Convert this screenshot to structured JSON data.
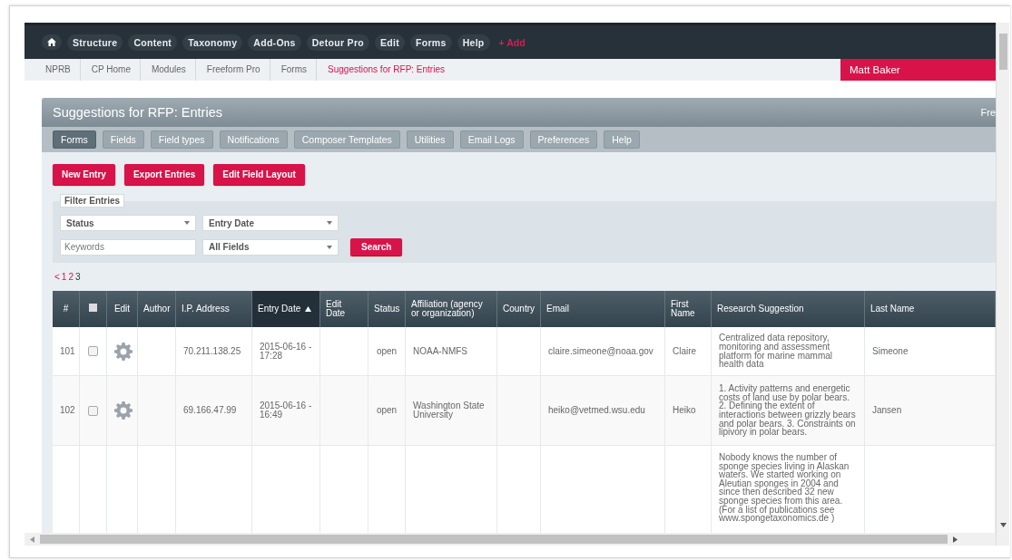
{
  "top_nav": [
    {
      "kind": "home"
    },
    {
      "kind": "menu",
      "label": "Structure"
    },
    {
      "kind": "menu",
      "label": "Content"
    },
    {
      "kind": "menu",
      "label": "Taxonomy"
    },
    {
      "kind": "menu",
      "label": "Add-Ons"
    },
    {
      "kind": "menu",
      "label": "Detour Pro"
    },
    {
      "kind": "menu",
      "label": "Edit"
    },
    {
      "kind": "menu",
      "label": "Forms"
    },
    {
      "kind": "menu",
      "label": "Help"
    },
    {
      "kind": "add",
      "label": "+ Add"
    }
  ],
  "breadcrumbs": [
    {
      "label": "NPRB",
      "current": false
    },
    {
      "label": "CP Home",
      "current": false
    },
    {
      "label": "Modules",
      "current": false
    },
    {
      "label": "Freeform Pro",
      "current": false
    },
    {
      "label": "Forms",
      "current": false
    },
    {
      "label": "Suggestions for RFP: Entries",
      "current": true
    }
  ],
  "user": "Matt Baker",
  "panel": {
    "title": "Suggestions for RFP: Entries",
    "title_right": "Fre",
    "tabs": [
      {
        "label": "Forms",
        "selected": true
      },
      {
        "label": "Fields",
        "selected": false
      },
      {
        "label": "Field types",
        "selected": false
      },
      {
        "label": "Notifications",
        "selected": false
      },
      {
        "label": "Composer Templates",
        "selected": false
      },
      {
        "label": "Utilities",
        "selected": false
      },
      {
        "label": "Email Logs",
        "selected": false
      },
      {
        "label": "Preferences",
        "selected": false
      },
      {
        "label": "Help",
        "selected": false
      }
    ],
    "actions": [
      "New Entry",
      "Export Entries",
      "Edit Field Layout"
    ],
    "filter": {
      "legend": "Filter Entries",
      "status_select": "Status",
      "date_select": "Entry Date",
      "keywords": {
        "placeholder": "Keywords"
      },
      "field_select": "All Fields",
      "search_button": "Search"
    },
    "pagination": [
      {
        "label": "<",
        "selected": false
      },
      {
        "label": "1",
        "selected": false
      },
      {
        "label": "2",
        "selected": false
      },
      {
        "label": "3",
        "selected": true
      }
    ],
    "table": {
      "columns": [
        {
          "kind": "text",
          "label": "#",
          "sorted": false
        },
        {
          "kind": "checkbox",
          "checked": false,
          "sorted": false
        },
        {
          "kind": "text",
          "label": "Edit",
          "sorted": false
        },
        {
          "kind": "text",
          "label": "Author",
          "sorted": false
        },
        {
          "kind": "text",
          "label": "I.P. Address",
          "sorted": false
        },
        {
          "kind": "text",
          "label": "Entry Date",
          "sorted": true
        },
        {
          "kind": "text",
          "label": "Edit Date",
          "sorted": false
        },
        {
          "kind": "text",
          "label": "Status",
          "sorted": false
        },
        {
          "kind": "text",
          "label": "Affiliation (agency or organization)",
          "sorted": false
        },
        {
          "kind": "text",
          "label": "Country",
          "sorted": false
        },
        {
          "kind": "text",
          "label": "Email",
          "sorted": false
        },
        {
          "kind": "text",
          "label": "First Name",
          "sorted": false
        },
        {
          "kind": "text",
          "label": "Research Suggestion",
          "sorted": false
        },
        {
          "kind": "text",
          "label": "Last Name",
          "sorted": false
        }
      ],
      "rows": [
        {
          "id": "101",
          "checked": false,
          "ip": "70.211.138.25",
          "entry_date": "2015-06-16 - 17:28",
          "status": "open",
          "affiliation": "NOAA-NMFS",
          "email": "claire.simeone@noaa.gov",
          "first_name": "Claire",
          "suggestion": "Centralized data repository, monitoring and assessment platform for marine mammal health data",
          "last_name": "Simeone"
        },
        {
          "id": "102",
          "checked": false,
          "ip": "69.166.47.99",
          "entry_date": "2015-06-16 - 16:49",
          "status": "open",
          "affiliation": "Washington State University",
          "email": "heiko@vetmed.wsu.edu",
          "first_name": "Heiko",
          "suggestion": "1. Activity patterns and energetic costs of land use by polar bears. 2. Defining the extent of interactions between grizzly bears and polar bears. 3. Constraints on lipivory in polar bears.",
          "last_name": "Jansen"
        },
        {
          "suggestion": "Nobody knows the number of sponge species living in Alaskan waters. We started working on Aleutian sponges in 2004 and since then described 32 new sponge species from this area. (For a list of publications see www.spongetaxonomics.de )"
        }
      ]
    }
  }
}
